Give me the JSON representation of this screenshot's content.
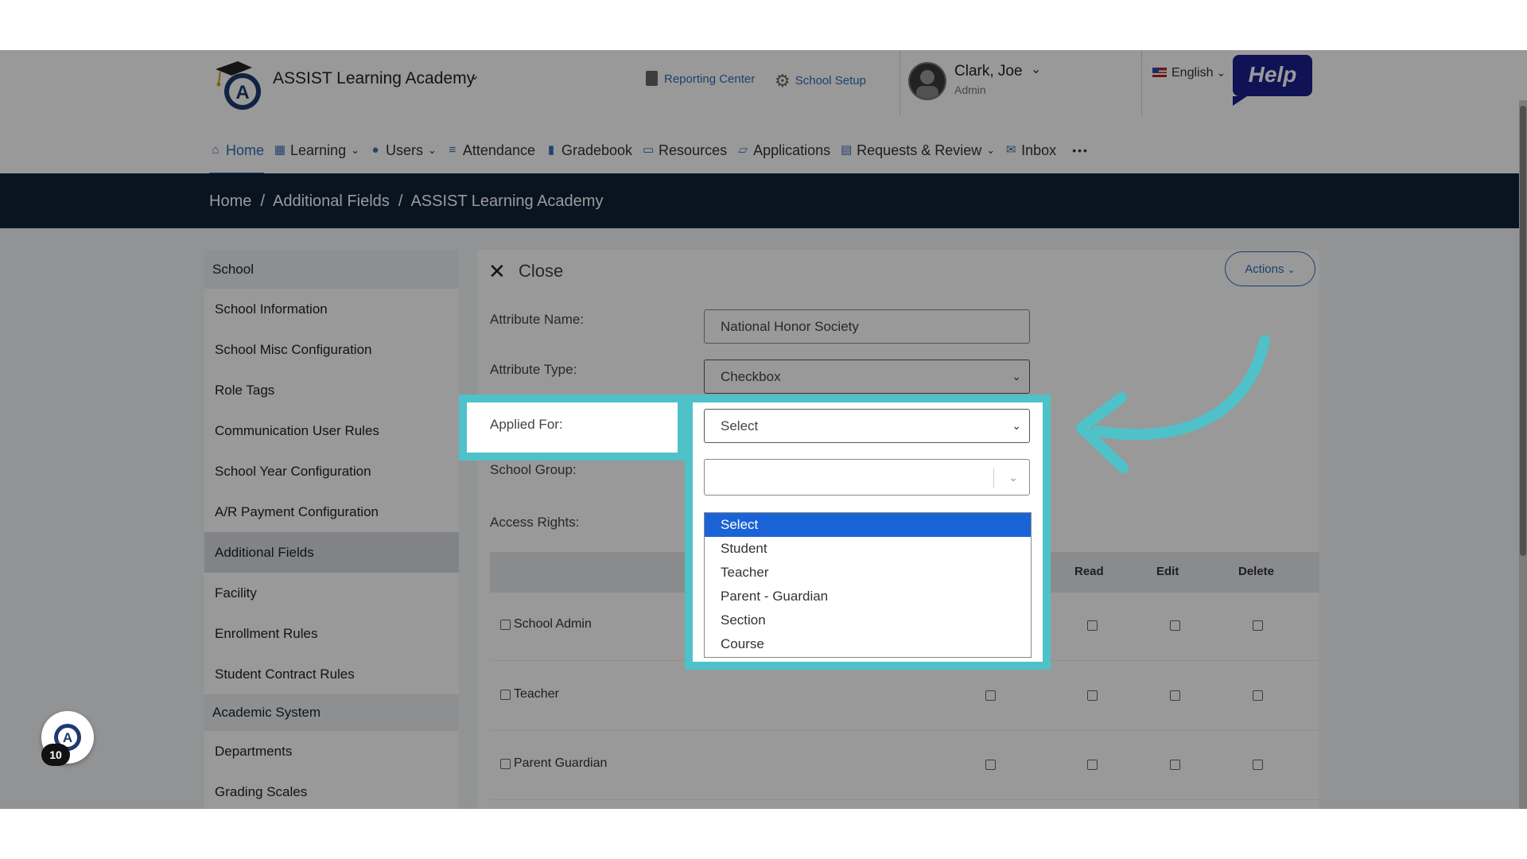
{
  "header": {
    "school_name": "ASSIST Learning Academy",
    "reporting_center": "Reporting Center",
    "school_setup": "School Setup",
    "user_name": "Clark, Joe",
    "user_role": "Admin",
    "language": "English",
    "help_label": "Help"
  },
  "nav": {
    "home": "Home",
    "learning": "Learning",
    "users": "Users",
    "attendance": "Attendance",
    "gradebook": "Gradebook",
    "resources": "Resources",
    "applications": "Applications",
    "requests_review": "Requests & Review",
    "inbox": "Inbox",
    "more": "•••"
  },
  "breadcrumb": "Home  /  Additional Fields  /  ASSIST Learning Academy",
  "sidebar": {
    "section_school": "School",
    "items": [
      "School Information",
      "School Misc Configuration",
      "Role Tags",
      "Communication User Rules",
      "School Year Configuration",
      "A/R Payment Configuration",
      "Additional Fields",
      "Facility",
      "Enrollment Rules",
      "Student Contract Rules"
    ],
    "section_academic": "Academic System",
    "items2": [
      "Departments",
      "Grading Scales"
    ]
  },
  "form": {
    "close_label": "Close",
    "actions_label": "Actions",
    "attribute_name_label": "Attribute Name:",
    "attribute_name_value": "National Honor Society",
    "attribute_type_label": "Attribute Type:",
    "attribute_type_value": "Checkbox",
    "applied_for_label": "Applied For:",
    "applied_for_value": "Select",
    "school_group_label": "School Group:",
    "access_rights_label": "Access Rights:"
  },
  "table": {
    "headers": {
      "read": "Read",
      "edit": "Edit",
      "delete": "Delete"
    },
    "rows": [
      "School Admin",
      "Teacher",
      "Parent Guardian"
    ]
  },
  "dropdown_options": [
    "Select",
    "Student",
    "Teacher",
    "Parent - Guardian",
    "Section",
    "Course"
  ],
  "widget_badge": "10",
  "colors": {
    "accent": "#2a6db8",
    "navbar_dark": "#0f2238",
    "highlight": "#4fc1c9",
    "selected_option": "#1a63d6",
    "help": "#1a1f8c"
  }
}
